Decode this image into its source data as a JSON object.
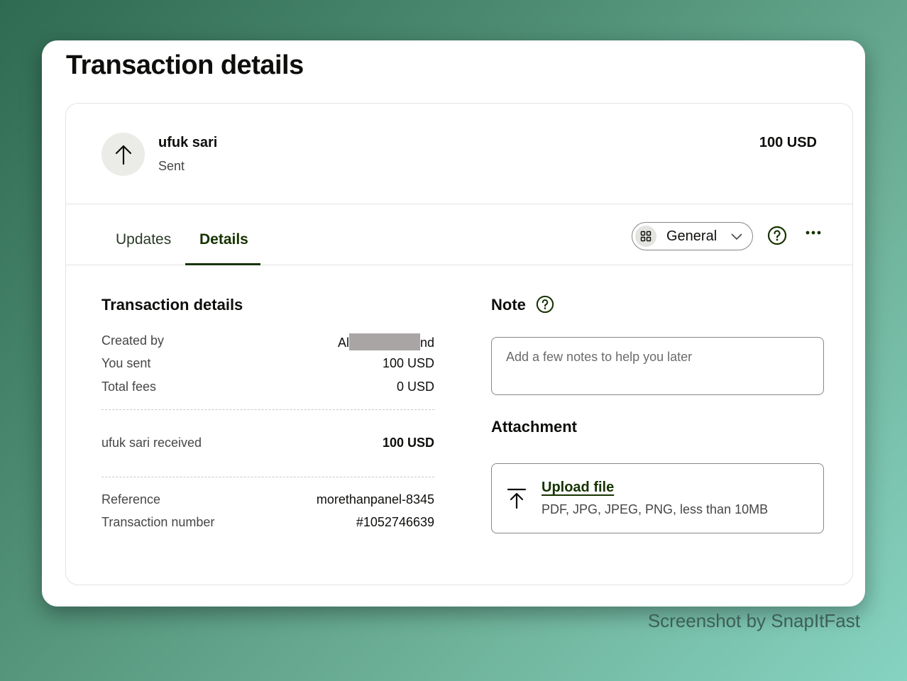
{
  "page_title": "Transaction details",
  "header": {
    "party_name": "ufuk sari",
    "status": "Sent",
    "amount": "100 USD",
    "avatar_icon": "arrow-up-icon"
  },
  "tabs": [
    {
      "label": "Updates",
      "active": false
    },
    {
      "label": "Details",
      "active": true
    }
  ],
  "toolbar": {
    "select_value": "General",
    "select_icon": "grid-icon",
    "help_icon": "help-icon",
    "more_icon": "more-icon"
  },
  "details": {
    "title": "Transaction details",
    "created_by_label": "Created by",
    "created_by_prefix": "Al",
    "created_by_suffix": "nd",
    "you_sent_label": "You sent",
    "you_sent_value": "100 USD",
    "total_fees_label": "Total fees",
    "total_fees_value": "0 USD",
    "received_label": "ufuk sari received",
    "received_value": "100 USD",
    "reference_label": "Reference",
    "reference_value": "morethanpanel-8345",
    "txn_number_label": "Transaction number",
    "txn_number_value": "#1052746639"
  },
  "note": {
    "title": "Note",
    "placeholder": "Add a few notes to help you later"
  },
  "attachment": {
    "title": "Attachment",
    "upload_label": "Upload file",
    "upload_hint": "PDF, JPG, JPEG, PNG, less than 10MB"
  },
  "watermark": "Screenshot by SnapItFast",
  "colors": {
    "accent": "#163300",
    "border": "#e3e3e0",
    "muted_text": "#454745"
  }
}
